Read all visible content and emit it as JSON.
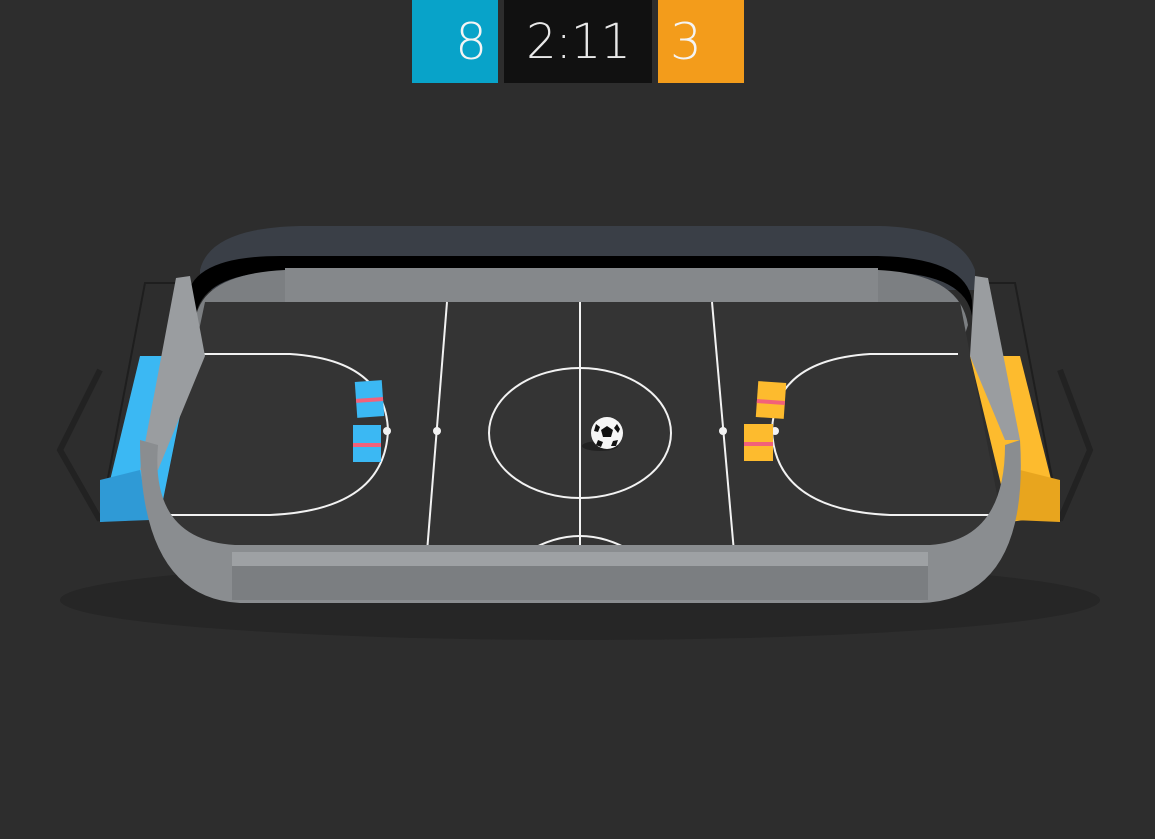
{
  "scoreboard": {
    "blue_score": "8",
    "timer": "2:11",
    "orange_score": "3"
  },
  "colors": {
    "background": "#2d2d2d",
    "blue_team": "#3bb8f3",
    "orange_team": "#fdbb2e",
    "score_blue": "#08a3c9",
    "score_orange": "#f39c1b",
    "timer_bg": "#111111",
    "field": "#343434",
    "wall": "#8a8d90",
    "accent_stripe": "#f2617a"
  },
  "scene": {
    "blue_players": 2,
    "orange_players": 2,
    "ball": "soccer-ball"
  }
}
